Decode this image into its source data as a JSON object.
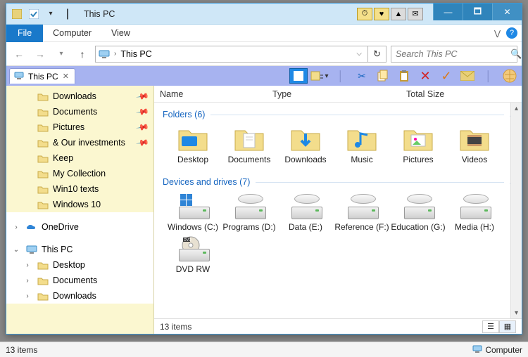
{
  "window": {
    "title": "This PC",
    "min": "—",
    "max": "🗖",
    "close": "✕"
  },
  "menubar": {
    "file": "File",
    "items": [
      "Computer",
      "View"
    ]
  },
  "nav": {
    "address": "This PC",
    "search_placeholder": "Search This PC"
  },
  "tab": {
    "label": "This PC"
  },
  "columns": {
    "name": "Name",
    "type": "Type",
    "totalsize": "Total Size"
  },
  "sidebar": {
    "quick": [
      {
        "label": "Downloads",
        "pinned": true
      },
      {
        "label": "Documents",
        "pinned": true
      },
      {
        "label": "Pictures",
        "pinned": true
      },
      {
        "label": "& Our investments",
        "pinned": true
      },
      {
        "label": "Keep",
        "pinned": false
      },
      {
        "label": "My Collection",
        "pinned": false
      },
      {
        "label": "Win10 texts",
        "pinned": false
      },
      {
        "label": "Windows 10",
        "pinned": false
      }
    ],
    "onedrive": "OneDrive",
    "thispc": "This PC",
    "thispc_children": [
      "Desktop",
      "Documents",
      "Downloads"
    ]
  },
  "groups": {
    "folders_hdr": "Folders (6)",
    "drives_hdr": "Devices and drives (7)"
  },
  "folders": [
    {
      "label": "Desktop"
    },
    {
      "label": "Documents"
    },
    {
      "label": "Downloads"
    },
    {
      "label": "Music"
    },
    {
      "label": "Pictures"
    },
    {
      "label": "Videos"
    }
  ],
  "drives": [
    {
      "label": "Windows (C:)"
    },
    {
      "label": "Programs (D:)"
    },
    {
      "label": "Data (E:)"
    },
    {
      "label": "Reference (F:)"
    },
    {
      "label": "Education (G:)"
    },
    {
      "label": "Media (H:)"
    },
    {
      "label": "DVD RW"
    }
  ],
  "status": {
    "items": "13 items",
    "outer_items": "13 items",
    "outer_right": "Computer"
  }
}
